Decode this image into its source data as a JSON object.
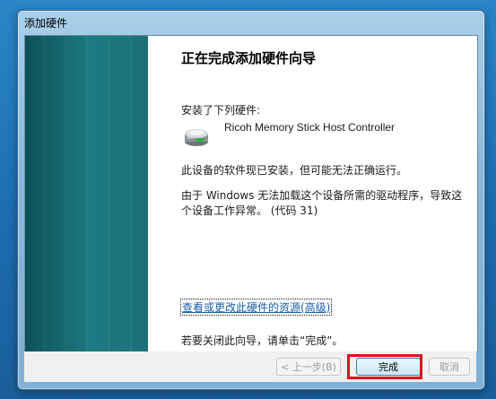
{
  "window": {
    "title": "添加硬件"
  },
  "wizard": {
    "heading": "正在完成添加硬件向导",
    "installed_label": "安装了下列硬件:",
    "device_name": "Ricoh Memory Stick Host Controller",
    "message_1": "此设备的软件现已安装，但可能无法正确运行。",
    "message_2": "由于 Windows 无法加载这个设备所需的驱动程序，导致这个设备工作异常。 (代码 31)",
    "resources_link": "查看或更改此硬件的资源(高级)",
    "close_hint": "若要关闭此向导，请单击“完成”。"
  },
  "buttons": {
    "back": "< 上一步(B)",
    "finish": "完成",
    "cancel": "取消"
  },
  "icons": {
    "device": "hardware-device-icon"
  },
  "colors": {
    "side_panel": "#1d7a82",
    "link": "#1a5ea8",
    "highlight": "#e01020"
  }
}
